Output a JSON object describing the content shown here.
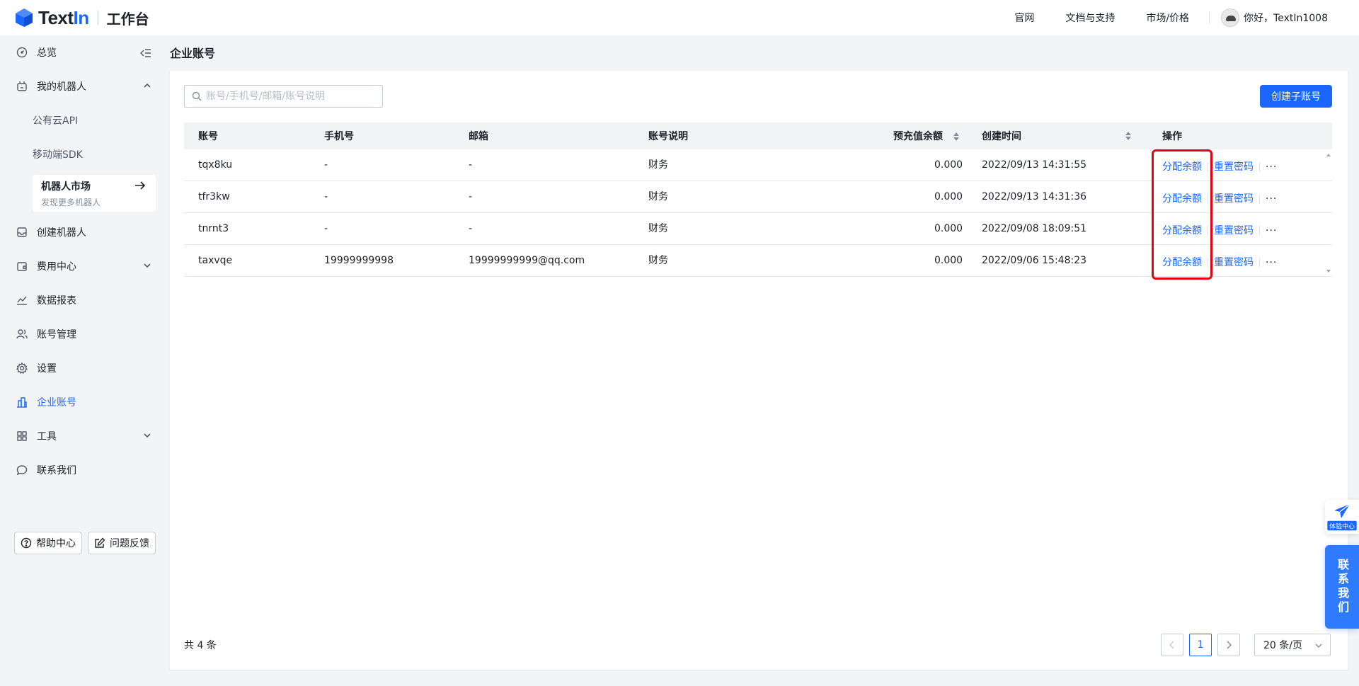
{
  "brand": {
    "logo_text_a": "Text",
    "logo_text_b": "In",
    "workspace": "工作台"
  },
  "topnav": {
    "links": [
      "官网",
      "文档与支持",
      "市场/价格"
    ],
    "user_greeting": "你好，TextIn1008"
  },
  "sidebar": {
    "overview": "总览",
    "my_robots": "我的机器人",
    "sub_public_api": "公有云API",
    "sub_mobile_sdk": "移动端SDK",
    "market_title": "机器人市场",
    "market_desc": "发现更多机器人",
    "create_robot": "创建机器人",
    "billing": "费用中心",
    "reports": "数据报表",
    "account_mgmt": "账号管理",
    "settings": "设置",
    "enterprise": "企业账号",
    "tools": "工具",
    "contact": "联系我们",
    "help_center": "帮助中心",
    "feedback": "问题反馈"
  },
  "main": {
    "page_title": "企业账号",
    "search_placeholder": "账号/手机号/邮箱/账号说明",
    "create_button": "创建子账号",
    "columns": {
      "account": "账号",
      "phone": "手机号",
      "email": "邮箱",
      "desc": "账号说明",
      "balance": "预充值余额",
      "created": "创建时间",
      "actions": "操作"
    },
    "rows": [
      {
        "account": "tqx8ku",
        "phone": "-",
        "email": "-",
        "desc": "财务",
        "balance": "0.000",
        "created": "2022/09/13 14:31:55"
      },
      {
        "account": "tfr3kw",
        "phone": "-",
        "email": "-",
        "desc": "财务",
        "balance": "0.000",
        "created": "2022/09/13 14:31:36"
      },
      {
        "account": "tnrnt3",
        "phone": "-",
        "email": "-",
        "desc": "财务",
        "balance": "0.000",
        "created": "2022/09/08 18:09:51"
      },
      {
        "account": "taxvqe",
        "phone": "19999999998",
        "email": "19999999999@qq.com",
        "desc": "财务",
        "balance": "0.000",
        "created": "2022/09/06 15:48:23"
      }
    ],
    "actions": {
      "allocate": "分配余额",
      "reset": "重置密码",
      "more": "···"
    },
    "total": "共 4 条",
    "pagination": {
      "prev": "<",
      "current_page": "1",
      "next": ">",
      "page_size": "20 条/页"
    }
  },
  "floating": {
    "experience": "体验中心",
    "contact": "联系我们"
  },
  "colors": {
    "accent": "#1a66ff",
    "highlight": "#e60012",
    "bg": "#f3f4f6"
  }
}
